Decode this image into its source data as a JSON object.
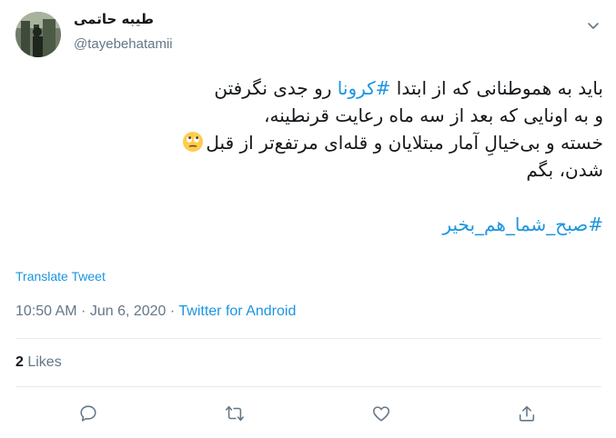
{
  "author": {
    "display_name": "طیبه حاتمی",
    "handle": "@tayebehatamii"
  },
  "tweet": {
    "line1_pre": "باید به هموطنانی که از ابتدا ",
    "line1_hashtag": "#کرونا",
    "line1_post": " رو جدی نگرفتن",
    "line2": "و به اونایی که بعد از سه ماه رعایت قرنطینه،",
    "line3": "خسته و بی‌خیالِ آمار مبتلایان و قله‌ای مرتفع‌تر از قبل",
    "line4": "شدن، بگم",
    "hashtag2": "#صبح_شما_هم_بخیر",
    "emoji": "face-with-rolling-eyes-icon"
  },
  "translate_label": "Translate Tweet",
  "meta": {
    "time": "10:50 AM",
    "separator1": " · ",
    "date": "Jun 6, 2020",
    "separator2": " · ",
    "source": "Twitter for Android"
  },
  "likes": {
    "count": "2",
    "label": " Likes"
  },
  "colors": {
    "link": "#1b95e0",
    "secondary": "#657786",
    "divider": "#e6ecf0"
  }
}
